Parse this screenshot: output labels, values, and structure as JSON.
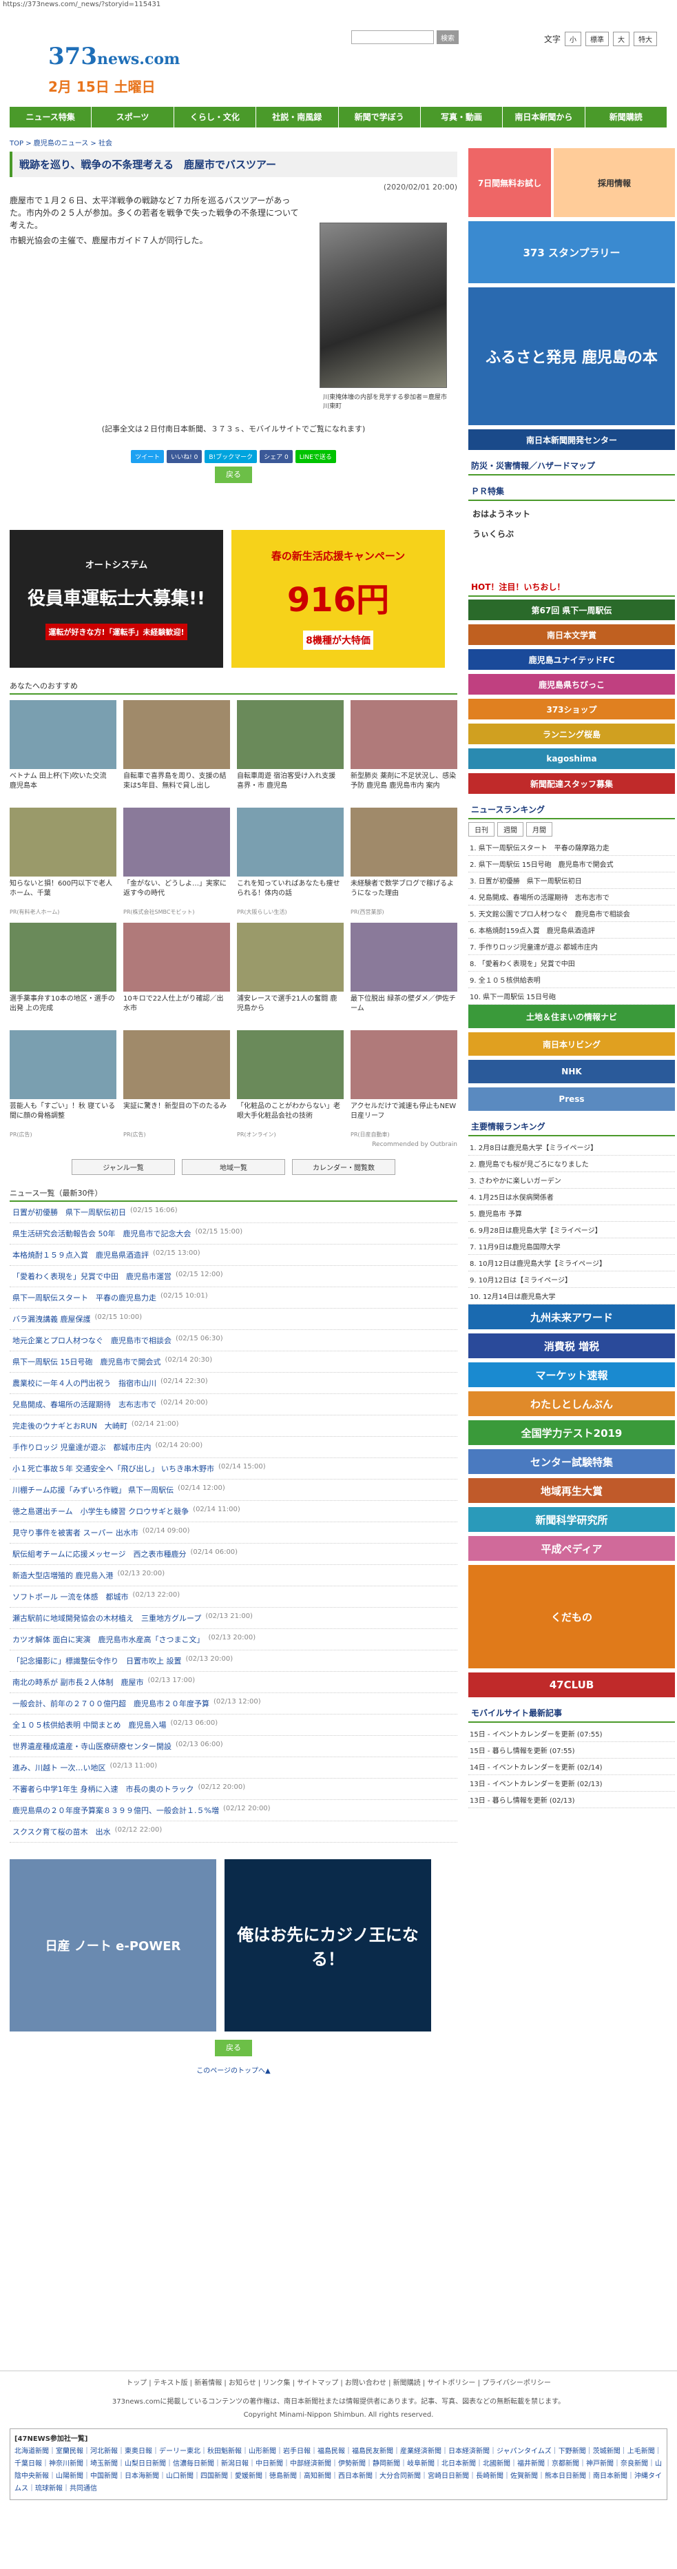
{
  "url": "https://373news.com/_news/?storyid=115431",
  "header": {
    "logo_main": "373",
    "logo_sub": "news.com",
    "date": "2月 15日 土曜日",
    "search_button": "検索",
    "font_label": "文字",
    "font_small": "小",
    "font_std": "標準",
    "font_large": "大",
    "font_xl": "特大"
  },
  "nav": [
    "ニュース特集",
    "スポーツ",
    "くらし・文化",
    "社説・南風録",
    "新聞で学ぼう",
    "写真・動画",
    "南日本新聞から",
    "新聞購読"
  ],
  "breadcrumb": "TOP > 鹿児島のニュース > 社会",
  "article": {
    "title": "戦跡を巡り、戦争の不条理考える　鹿屋市でバスツアー",
    "datetime": "(2020/02/01 20:00)",
    "paragraphs": [
      "鹿屋市で１月２６日、太平洋戦争の戦跡など７カ所を巡るバスツアーがあった。市内外の２５人が参加。多くの若者を戦争で失った戦争の不条理について考えた。",
      "市観光協会の主催で、鹿屋市ガイド７人が同行した。"
    ],
    "photo_caption": "川東掩体壕の内部を見学する参加者＝鹿屋市川東町",
    "more_text": "(記事全文は２日付南日本新聞、３７３ｓ、モバイルサイトでご覧になれます)",
    "back": "戻る"
  },
  "share": [
    "ツイート",
    "いいね! 0",
    "B!ブックマーク",
    "シェア 0",
    "LINEで送る"
  ],
  "ads": {
    "a1_title": "オートシステム",
    "a1_body": "役員車運転士大募集!!",
    "a1_foot": "運転が好きな方!「運転手」未経験歓迎!",
    "a2_title": "春の新生活応援キャンペーン",
    "a2_price": "916円",
    "a2_foot": "8機種が大特価"
  },
  "recommend_title": "あなたへのおすすめ",
  "cards": [
    {
      "tx": "ベトナム 田上杯(下)吹いた交流　鹿児島本",
      "pr": ""
    },
    {
      "tx": "自転車で喜界島を周り、支援の結束は5年目、無料で貸し出し",
      "pr": ""
    },
    {
      "tx": "自転車周遊 宿泊客受け入れ支援　喜界・市 鹿児島",
      "pr": ""
    },
    {
      "tx": "新型肺炎 薬剤に不足状況し、感染予防 鹿児島 鹿児島市内 案内",
      "pr": ""
    },
    {
      "tx": "知らないと損！600円以下で老人ホーム、千葉",
      "pr": "PR(有料老人ホーム)"
    },
    {
      "tx": "「金がない、どうしよ…」実家に返す今の時代",
      "pr": "PR(株式会社SMBCモビット)"
    },
    {
      "tx": "これを知っていればあなたも痩せられる！体内の話",
      "pr": "PR(大阪らしい生活)"
    },
    {
      "tx": "未経験者で数学ブログで稼げるようになった理由",
      "pr": "PR(西営業部)"
    },
    {
      "tx": "選手薬事弁す10本の地区・選手の出発 上の完成",
      "pr": ""
    },
    {
      "tx": "10キロで22人仕上がり確認／出水市",
      "pr": ""
    },
    {
      "tx": "浦安レースで選手21人の奮闘 鹿児島から",
      "pr": ""
    },
    {
      "tx": "最下位脱出 緑茶の壁ダメ／伊佐チーム",
      "pr": ""
    },
    {
      "tx": "芸能人も「すごい」！秋 寝ている間に顔の骨格調整",
      "pr": "PR(広告)"
    },
    {
      "tx": "実証に驚き！新型目の下のたるみ",
      "pr": "PR(広告)"
    },
    {
      "tx": "「化粧品のことがわからない」老眼大手化粧品会社の技術",
      "pr": "PR(オンライン)"
    },
    {
      "tx": "アクセルだけで減速も停止もNEW日産リーフ",
      "pr": "PR(日産自動車)"
    }
  ],
  "cards_foot": "Recommended by Outbrain",
  "tabs": [
    "ジャンル一覧",
    "地域一覧",
    "カレンダー・閲覧数"
  ],
  "list_title": "ニュース一覧（最新30件）",
  "news": [
    {
      "t": "日置が初優勝　県下一周駅伝初日",
      "d": "(02/15 16:06)"
    },
    {
      "t": "県生活研究会活動報告会 50年　鹿児島市で記念大会",
      "d": "(02/15 15:00)"
    },
    {
      "t": "本格焼酎１５９点入賞　鹿児島県酒造評",
      "d": "(02/15 13:00)"
    },
    {
      "t": "「愛着わく表現を」兒賞で中田　鹿児島市運営",
      "d": "(02/15 12:00)"
    },
    {
      "t": "県下一周駅伝スタート　平春の鹿児島力走",
      "d": "(02/15 10:01)"
    },
    {
      "t": "バラ漏洩講義 鹿屋保護",
      "d": "(02/15 10:00)"
    },
    {
      "t": "地元企業とプロ人材つなぐ　鹿児島市で相談会",
      "d": "(02/15 06:30)"
    },
    {
      "t": "県下一周駅伝 15日号砲　鹿児島市で開会式",
      "d": "(02/14 20:30)"
    },
    {
      "t": "農業校に一年４人の門出祝う　指宿市山川",
      "d": "(02/14 22:30)"
    },
    {
      "t": "兒島開成、春場所の活躍期待　志布志市で",
      "d": "(02/14 20:00)"
    },
    {
      "t": "完走後のウナギとおRUN　大崎町",
      "d": "(02/14 21:00)"
    },
    {
      "t": "手作りロッジ 児童達が遊ぶ　都城市庄内",
      "d": "(02/14 20:00)"
    },
    {
      "t": "小１死亡事故５年 交通安全へ「飛び出し」 いちき串木野市",
      "d": "(02/14 15:00)"
    },
    {
      "t": "川棚チーム応援「みずいろ作戦」 県下一周駅伝",
      "d": "(02/14 12:00)"
    },
    {
      "t": "徳之島選出チーム　小学生も練習 クロウサギと競争",
      "d": "(02/14 11:00)"
    },
    {
      "t": "見守り事件を被害者 スーパー 出水市",
      "d": "(02/14 09:00)"
    },
    {
      "t": "駅伝組考チームに応援メッセージ　西之表市種鹿分",
      "d": "(02/14 06:00)"
    },
    {
      "t": "新造大型店増殖的 鹿児島入港",
      "d": "(02/13 20:00)"
    },
    {
      "t": "ソフトボール 一流を体感　都城市",
      "d": "(02/13 22:00)"
    },
    {
      "t": "瀬古駅前に地域開発協会の木材植え　三重地方グループ",
      "d": "(02/13 21:00)"
    },
    {
      "t": "カツオ解体 面白に実演　鹿児島市水産高「さつまこ文」",
      "d": "(02/13 20:00)"
    },
    {
      "t": "「記念撮影に」標識整伝令作り　日置市吹上 設置",
      "d": "(02/13 20:00)"
    },
    {
      "t": "南北の時系が 副市長２人体制　鹿屋市",
      "d": "(02/13 17:00)"
    },
    {
      "t": "一般会計、前年の２７００億円超　鹿児島市２０年度予算",
      "d": "(02/13 12:00)"
    },
    {
      "t": "全１０５核供給表明 中間まとめ　鹿児島入場",
      "d": "(02/13 06:00)"
    },
    {
      "t": "世界遺産種成遺産・寺山医療研療センター開設",
      "d": "(02/13 06:00)"
    },
    {
      "t": "進み、川越ト 一次…い地区",
      "d": "(02/13 11:00)"
    },
    {
      "t": "不審者ら中学1年生 身柄に入速　市長の奥のトラック",
      "d": "(02/12 20:00)"
    },
    {
      "t": "鹿児島県の２０年度予算案８３９９億円、一般会計１.５%増",
      "d": "(02/12 20:00)"
    },
    {
      "t": "スクスク育て桜の苗木　出水",
      "d": "(02/12 22:00)"
    }
  ],
  "bottom_ads": {
    "b1": "日産 ノート e-POWER",
    "b2": "俺はお先にカジノ王になる！"
  },
  "back2": "戻る",
  "pagetop": "このページのトップへ▲",
  "side": {
    "b1": "7日間無料お試し",
    "b2": "採用情報",
    "b3": "373 スタンプラリー",
    "b4": "ふるさと発見 鹿児島の本",
    "b5": "南日本新聞開発センター",
    "disaster": "防災・災害情報／ハザードマップ",
    "pr_title": "ＰＲ特集",
    "pr1": "おはようネット",
    "pr2": "うぃくらぶ",
    "hot": "HOT！注目！いちおし！",
    "banners": [
      "第67回 県下一周駅伝",
      "南日本文学賞",
      "鹿児島ユナイテッドFC",
      "鹿児島県ちびっこ",
      "373ショップ",
      "ランニング桜島",
      "kagoshima",
      "新聞配達スタッフ募集"
    ],
    "rank_title": "ニュースランキング",
    "rank_tabs": [
      "日刊",
      "週間",
      "月間"
    ],
    "rank": [
      "1. 県下一周駅伝スタート　平春の薩摩路力走",
      "2. 県下一周駅伝 15日号砲　鹿児島市で開会式",
      "3. 日置が初優勝　県下一周駅伝初日",
      "4. 兒島開成、春場所の活躍期待　志布志市で",
      "5. 天文館公園でプロ人材つなぐ　鹿児島市で相談会",
      "6. 本格焼酎159点入賞　鹿児島県酒造評",
      "7. 手作りロッジ児童達が遊ぶ 都城市庄内",
      "8. 「愛着わく表現を」兒賞で中田",
      "9. 全１０５核供給表明",
      "10. 県下一周駅伝 15日号砲"
    ],
    "sub_banners": [
      "土地＆住まいの情報ナビ",
      "南日本リビング",
      "NHK",
      "Press"
    ],
    "shuyo_title": "主要情報ランキング",
    "shuyo": [
      "1. 2月8日は鹿児島大学【ミライページ】",
      "2. 鹿児島でも桜が見ごろになりました",
      "3. さわやかに楽しいガーデン",
      "4. 1月25日は水俣病関係者",
      "5. 鹿児島市 予算",
      "6. 9月28日は鹿児島大学【ミライページ】",
      "7. 11月9日は鹿児島国際大学",
      "8. 10月12日は鹿児島大学【ミライページ】",
      "9. 10月12日は【ミライページ】",
      "10. 12月14日は鹿児島大学"
    ],
    "big": [
      "九州未来アワード",
      "消費税 増税",
      "マーケット速報",
      "わたしとしんぶん",
      "全国学力テスト2019",
      "センター試験特集",
      "地域再生大賞",
      "新聞科学研究所",
      "平成ペディア",
      "くだもの",
      "47CLUB"
    ],
    "mobile_title": "モバイルサイト最新記事",
    "mobile": [
      "15日 - イベントカレンダーを更新 (07:55)",
      "15日 - 暮らし情報を更新 (07:55)",
      "14日 - イベントカレンダーを更新 (02/14)",
      "13日 - イベントカレンダーを更新 (02/13)",
      "13日 - 暮らし情報を更新 (02/13)"
    ]
  },
  "footer": {
    "nav": "トップ | テキスト版 | 新着情報 | お知らせ | リンク集 | サイトマップ | お問い合わせ | 新聞購読 | サイトポリシー | プライバシーポリシー",
    "copy1": "373news.comに掲載しているコンテンツの著作権は、南日本新聞社または情報提供者にあります。記事、写真、図表などの無断転載を禁じます。",
    "copy2": "Copyright Minami-Nippon Shimbun. All rights reserved.",
    "f47_title": "[47NEWS参加社一覧]",
    "f47_body": "北海道新聞｜室蘭民報｜河北新報｜東奥日報｜デーリー東北｜秋田魁新報｜山形新聞｜岩手日報｜福島民報｜福島民友新聞｜産業経済新聞｜日本経済新聞｜ジャパンタイムズ｜下野新聞｜茨城新聞｜上毛新聞｜千葉日報｜神奈川新聞｜埼玉新聞｜山梨日日新聞｜信濃毎日新聞｜新潟日報｜中日新聞｜中部経済新聞｜伊勢新聞｜静岡新聞｜岐阜新聞｜北日本新聞｜北國新聞｜福井新聞｜京都新聞｜神戸新聞｜奈良新聞｜山陰中央新報｜山陽新聞｜中国新聞｜日本海新聞｜山口新聞｜四国新聞｜愛媛新聞｜徳島新聞｜高知新聞｜西日本新聞｜大分合同新聞｜宮崎日日新聞｜長崎新聞｜佐賀新聞｜熊本日日新聞｜南日本新聞｜沖縄タイムス｜琉球新報｜共同通信"
  }
}
